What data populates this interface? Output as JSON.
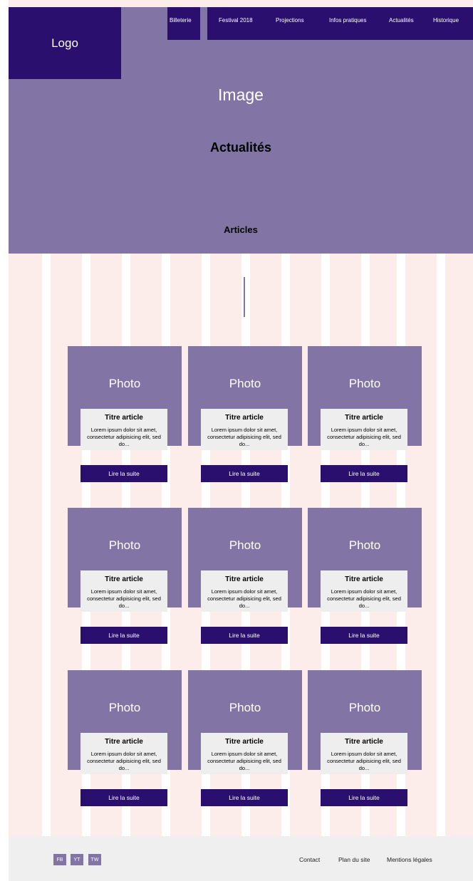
{
  "header": {
    "logo": "Logo",
    "nav": [
      "Billeterie",
      "Festival 2018",
      "Projections",
      "Infos pratiques",
      "Actualités",
      "Historique"
    ]
  },
  "hero": {
    "image_label": "Image",
    "title": "Actualités",
    "subtitle": "Articles"
  },
  "articles": [
    {
      "photo": "Photo",
      "title": "Titre article",
      "excerpt": "Lorem ipsum dolor sit amet, consectetur adipisicing elit, sed do...",
      "button": "Lire la suite"
    },
    {
      "photo": "Photo",
      "title": "Titre article",
      "excerpt": "Lorem ipsum dolor sit amet, consectetur adipisicing elit, sed do...",
      "button": "Lire la suite"
    },
    {
      "photo": "Photo",
      "title": "Titre article",
      "excerpt": "Lorem ipsum dolor sit amet, consectetur adipisicing elit, sed do...",
      "button": "Lire la suite"
    },
    {
      "photo": "Photo",
      "title": "Titre article",
      "excerpt": "Lorem ipsum dolor sit amet, consectetur adipisicing elit, sed do...",
      "button": "Lire la suite"
    },
    {
      "photo": "Photo",
      "title": "Titre article",
      "excerpt": "Lorem ipsum dolor sit amet, consectetur adipisicing elit, sed do...",
      "button": "Lire la suite"
    },
    {
      "photo": "Photo",
      "title": "Titre article",
      "excerpt": "Lorem ipsum dolor sit amet, consectetur adipisicing elit, sed do...",
      "button": "Lire la suite"
    },
    {
      "photo": "Photo",
      "title": "Titre article",
      "excerpt": "Lorem ipsum dolor sit amet, consectetur adipisicing elit, sed do...",
      "button": "Lire la suite"
    },
    {
      "photo": "Photo",
      "title": "Titre article",
      "excerpt": "Lorem ipsum dolor sit amet, consectetur adipisicing elit, sed do...",
      "button": "Lire la suite"
    },
    {
      "photo": "Photo",
      "title": "Titre article",
      "excerpt": "Lorem ipsum dolor sit amet, consectetur adipisicing elit, sed do...",
      "button": "Lire la suite"
    }
  ],
  "footer": {
    "social": [
      "FB",
      "YT",
      "TW"
    ],
    "links": [
      "Contact",
      "Plan du site",
      "Mentions légales"
    ]
  },
  "colors": {
    "primary_dark": "#2a0f6e",
    "primary_light": "#8274a5",
    "background_pink": "#fcecea",
    "footer_bg": "#efefef"
  }
}
